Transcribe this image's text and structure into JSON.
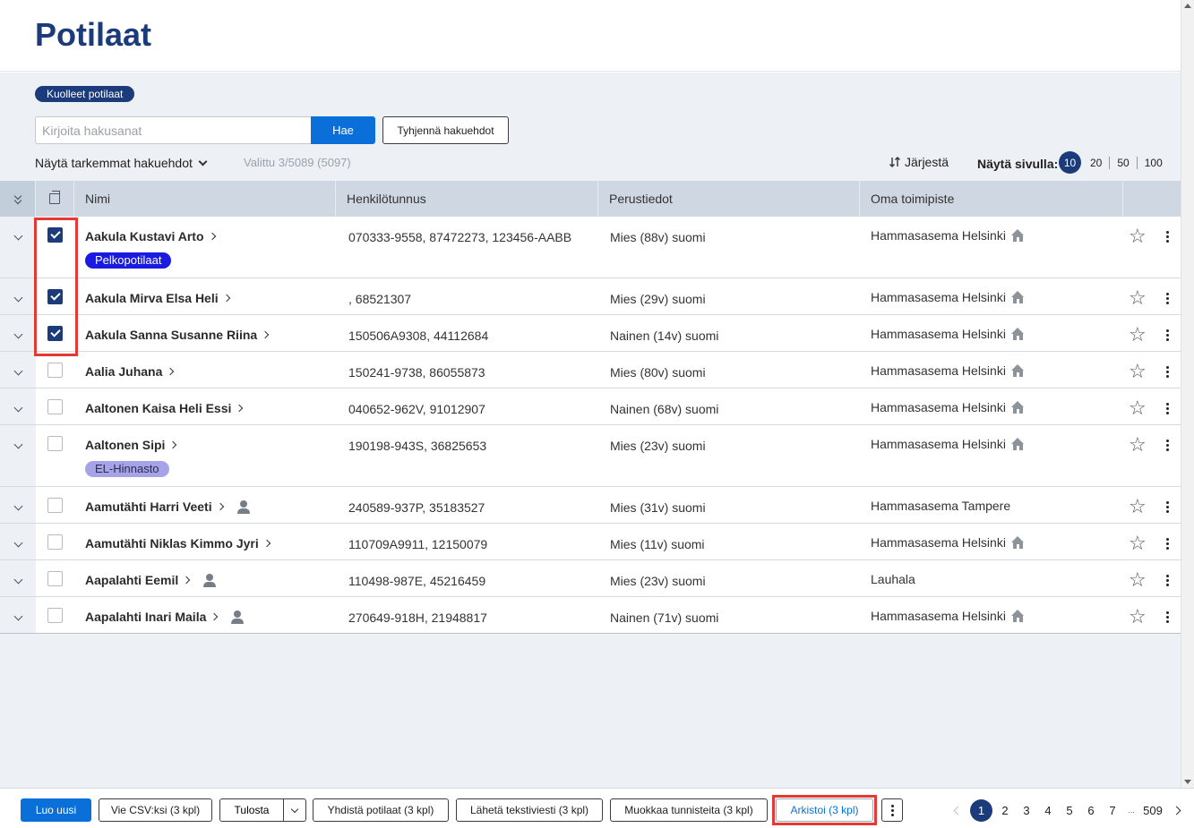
{
  "page": {
    "title": "Potilaat"
  },
  "filters": {
    "deceased_label": "Kuolleet potilaat",
    "search_placeholder": "Kirjoita hakusanat",
    "search_value": "",
    "search_button": "Hae",
    "clear_button": "Tyhjennä hakuehdot",
    "advanced_toggle": "Näytä tarkemmat hakuehdot",
    "selected_count": "Valittu 3/5089 (5097)",
    "sort_label": "Järjestä",
    "per_page_label": "Näytä sivulla:",
    "per_page_options": [
      "10",
      "20",
      "50",
      "100"
    ],
    "per_page_selected": "10"
  },
  "table": {
    "columns": {
      "name": "Nimi",
      "ssn": "Henkilötunnus",
      "basic": "Perustiedot",
      "office": "Oma toimipiste"
    },
    "rows": [
      {
        "checked": true,
        "name": "Aakula Kustavi Arto",
        "ssn": "070333-9558, 87472273, 123456-AABB",
        "basic": "Mies (88v) suomi",
        "office": "Hammasasema Helsinki",
        "home": true,
        "person": false,
        "tag": "Pelkopotilaat",
        "tag_color": "#1a1ae0"
      },
      {
        "checked": true,
        "name": "Aakula Mirva Elsa Heli",
        "ssn": ", 68521307",
        "basic": "Mies (29v) suomi",
        "office": "Hammasasema Helsinki",
        "home": true,
        "person": false,
        "tag": ""
      },
      {
        "checked": true,
        "name": "Aakula Sanna Susanne Riina",
        "ssn": "150506A9308, 44112684",
        "basic": "Nainen (14v) suomi",
        "office": "Hammasasema Helsinki",
        "home": true,
        "person": false,
        "tag": ""
      },
      {
        "checked": false,
        "name": "Aalia Juhana",
        "ssn": "150241-9738, 86055873",
        "basic": "Mies (80v) suomi",
        "office": "Hammasasema Helsinki",
        "home": true,
        "person": false,
        "tag": ""
      },
      {
        "checked": false,
        "name": "Aaltonen Kaisa Heli Essi",
        "ssn": "040652-962V, 91012907",
        "basic": "Nainen (68v) suomi",
        "office": "Hammasasema Helsinki",
        "home": true,
        "person": false,
        "tag": ""
      },
      {
        "checked": false,
        "name": "Aaltonen Sipi",
        "ssn": "190198-943S, 36825653",
        "basic": "Mies (23v) suomi",
        "office": "Hammasasema Helsinki",
        "home": true,
        "person": false,
        "tag": "EL-Hinnasto",
        "tag_color": "#a7a3e8"
      },
      {
        "checked": false,
        "name": "Aamutähti Harri Veeti",
        "ssn": "240589-937P, 35183527",
        "basic": "Mies (31v) suomi",
        "office": "Hammasasema Tampere",
        "home": false,
        "person": true,
        "tag": ""
      },
      {
        "checked": false,
        "name": "Aamutähti Niklas Kimmo Jyri",
        "ssn": "110709A9911, 12150079",
        "basic": "Mies (11v) suomi",
        "office": "Hammasasema Helsinki",
        "home": true,
        "person": false,
        "tag": ""
      },
      {
        "checked": false,
        "name": "Aapalahti Eemil",
        "ssn": "110498-987E, 45216459",
        "basic": "Mies (23v) suomi",
        "office": "Lauhala",
        "home": false,
        "person": true,
        "tag": ""
      },
      {
        "checked": false,
        "name": "Aapalahti Inari Maila",
        "ssn": "270649-918H, 21948817",
        "basic": "Nainen (71v) suomi",
        "office": "Hammasasema Helsinki",
        "home": true,
        "person": true,
        "tag": ""
      }
    ]
  },
  "footer": {
    "create": "Luo uusi",
    "csv": "Vie CSV:ksi (3 kpl)",
    "print": "Tulosta",
    "merge": "Yhdistä potilaat (3 kpl)",
    "sms": "Lähetä tekstiviesti (3 kpl)",
    "edit_tags": "Muokkaa tunnisteita (3 kpl)",
    "archive": "Arkistoi (3 kpl)"
  },
  "pagination": {
    "current": "1",
    "pages": [
      "2",
      "3",
      "4",
      "5",
      "6",
      "7"
    ],
    "ellipsis": "...",
    "last": "509"
  },
  "colors": {
    "brand": "#1c3b7a",
    "primary": "#0a6fd8",
    "highlight": "#e53935"
  }
}
